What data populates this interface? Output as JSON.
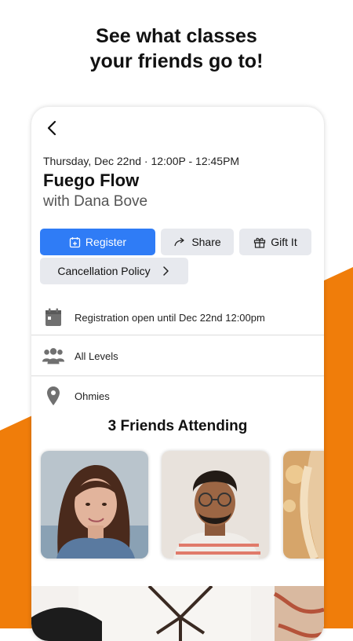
{
  "headline": {
    "line1": "See what classes",
    "line2": "your friends go to!"
  },
  "class_detail": {
    "date_time": "Thursday, Dec 22nd · 12:00P - 12:45PM",
    "title": "Fuego Flow",
    "instructor": "with Dana Bove"
  },
  "actions": {
    "register_label": "Register",
    "share_label": "Share",
    "gift_label": "Gift It",
    "cancellation_label": "Cancellation Policy"
  },
  "info": [
    {
      "icon": "calendar-icon",
      "text": "Registration open until Dec 22nd 12:00pm"
    },
    {
      "icon": "people-icon",
      "text": "All Levels"
    },
    {
      "icon": "location-pin-icon",
      "text": "Ohmies"
    }
  ],
  "friends": {
    "title": "3 Friends Attending",
    "avatars": [
      "friend-photo-woman",
      "friend-photo-man-glasses",
      "friend-photo-partial"
    ]
  },
  "colors": {
    "accent_orange": "#f07d0a",
    "register_blue": "#2f7cf6",
    "secondary_button": "#e7e9ee"
  }
}
